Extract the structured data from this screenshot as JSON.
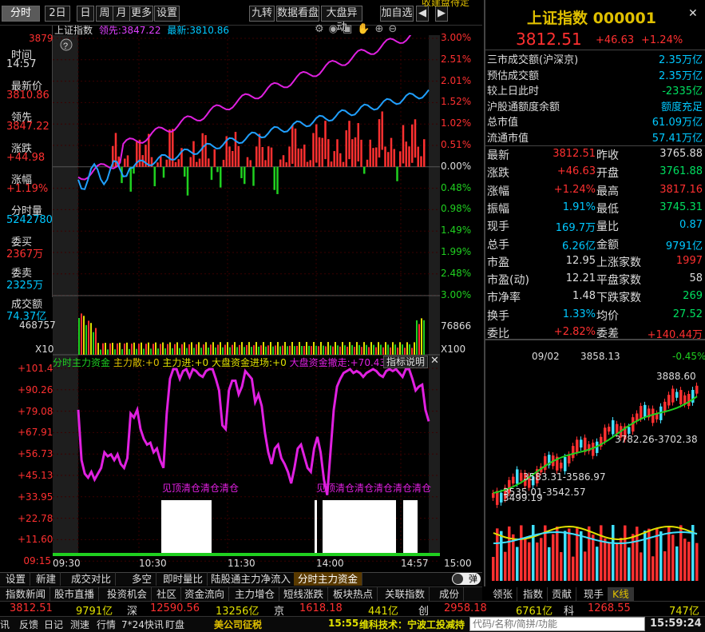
{
  "toolbar": {
    "items": [
      "分时",
      "2日",
      "日",
      "周",
      "月",
      "更多",
      "设置",
      "九转",
      "数据看盘",
      "大盘异动",
      "加自选"
    ],
    "ticker_partial": "收建盘待定"
  },
  "index_header": {
    "name": "上证指数",
    "code": "000001",
    "price": "3812.51",
    "change": "+46.63",
    "change_pct": "+1.24%"
  },
  "chart_header": {
    "name": "上证指数",
    "lead_label": "领先:",
    "lead_value": "3847.22",
    "latest_label": "最新:",
    "latest_value": "3810.86"
  },
  "left_info": [
    {
      "label": "时间",
      "value": "14:57",
      "color": "#dddddd"
    },
    {
      "label": "最新价",
      "value": "3810.86",
      "color": "#ff3030"
    },
    {
      "label": "领先",
      "value": "3847.22",
      "color": "#ff3030"
    },
    {
      "label": "涨跌",
      "value": "+44.98",
      "color": "#ff3030"
    },
    {
      "label": "涨幅",
      "value": "+1.19%",
      "color": "#ff3030"
    },
    {
      "label": "分时量",
      "value": "5242780",
      "color": "#00c8ff"
    },
    {
      "label": "委买",
      "value": "2367万",
      "color": "#ff3030"
    },
    {
      "label": "委卖",
      "value": "2325万",
      "color": "#00c8ff"
    },
    {
      "label": "成交额",
      "value": "74.37亿",
      "color": "#00c8ff"
    }
  ],
  "y_left_top": "3879",
  "pct_axis": [
    "3.00%",
    "2.51%",
    "2.01%",
    "1.52%",
    "1.02%",
    "0.51%",
    "0.00%",
    "0.48%",
    "0.98%",
    "1.49%",
    "1.99%",
    "2.48%",
    "3.00%"
  ],
  "volume": {
    "left_value": "468757",
    "right_value": "76866",
    "left_mult": "X10",
    "right_mult": "X100"
  },
  "indicator": {
    "title": "分时主力资金",
    "a_label": "主力散:",
    "a_value": "+0",
    "b_label": "主力进:",
    "b_value": "+0",
    "c_label": "大盘资金进场:",
    "c_value": "+0",
    "d_label": "大盘资金撤走:",
    "d_value": "+70.43",
    "help": "指标说明",
    "note_a": "见顶清仓清仓清仓",
    "note_b": "见顶清仓清仓清仓清仓清仓",
    "axis": [
      "+101.4",
      "+90.26",
      "+79.08",
      "+67.91",
      "+56.73",
      "+45.13",
      "+33.95",
      "+22.78",
      "+11.60",
      "09:15"
    ],
    "series": [
      80,
      54,
      47,
      45,
      48,
      44,
      47,
      50,
      58,
      56,
      57,
      54,
      57,
      52,
      50,
      55,
      78,
      76,
      80,
      70,
      65,
      62,
      63,
      58,
      60,
      54,
      50,
      78,
      96,
      101,
      101,
      96,
      100,
      101,
      97,
      101,
      100,
      98,
      97,
      100,
      101,
      101,
      96,
      90,
      72,
      70,
      90,
      95,
      95,
      88,
      92,
      100,
      98,
      96,
      84,
      88,
      82,
      68,
      58,
      52,
      60,
      62,
      55,
      52,
      48,
      42,
      50,
      60,
      62,
      56,
      50,
      48,
      60,
      66,
      58,
      44,
      36,
      58,
      80,
      92,
      96,
      99,
      100,
      101,
      99,
      100,
      99,
      97,
      99,
      100,
      101,
      100,
      98,
      97,
      100,
      101,
      100,
      101,
      99,
      97,
      101,
      101,
      96,
      90,
      92,
      93,
      80,
      74
    ]
  },
  "time_axis": [
    "09:30",
    "10:30",
    "11:30",
    "14:00",
    "14:57",
    "15:00"
  ],
  "bottom_tabs": [
    "设置",
    "新建",
    "成交对比",
    "多空",
    "即时量比",
    "陆股通主力净流入",
    "分时主力资金"
  ],
  "toggle_label": "弹",
  "stats_block": {
    "lines": [
      {
        "label": "三市成交额(沪深京)",
        "value": "2.35万亿",
        "color": "#00c8ff"
      },
      {
        "label": "预估成交额",
        "value": "2.35万亿",
        "color": "#00c8ff"
      },
      {
        "label": "较上日此时",
        "value": "-2335亿",
        "color": "#00e060"
      },
      {
        "label": "沪股通额度余额",
        "value": "额度充足",
        "color": "#00c8ff"
      },
      {
        "label": "总市值",
        "value": "61.09万亿",
        "color": "#00c8ff"
      },
      {
        "label": "流通市值",
        "value": "57.41万亿",
        "color": "#00c8ff"
      }
    ]
  },
  "grid_rows": [
    {
      "k1": "最新",
      "v1": "3812.51",
      "c1": "#ff3030",
      "k2": "昨收",
      "v2": "3765.88",
      "c2": "#dddddd"
    },
    {
      "k1": "涨跌",
      "v1": "+46.63",
      "c1": "#ff3030",
      "k2": "开盘",
      "v2": "3761.88",
      "c2": "#00e060"
    },
    {
      "k1": "涨幅",
      "v1": "+1.24%",
      "c1": "#ff3030",
      "k2": "最高",
      "v2": "3817.16",
      "c2": "#ff3030"
    },
    {
      "k1": "振幅",
      "v1": "1.91%",
      "c1": "#00c8ff",
      "k2": "最低",
      "v2": "3745.31",
      "c2": "#00e060"
    },
    {
      "k1": "现手",
      "v1": "169.7万",
      "c1": "#00c8ff",
      "k2": "量比",
      "v2": "0.87",
      "c2": "#00c8ff"
    },
    {
      "k1": "总手",
      "v1": "6.26亿",
      "c1": "#00c8ff",
      "k2": "金额",
      "v2": "9791亿",
      "c2": "#00c8ff"
    },
    {
      "k1": "市盈",
      "v1": "12.95",
      "c1": "#dddddd",
      "k2": "上涨家数",
      "v2": "1997",
      "c2": "#ff3030"
    },
    {
      "k1": "市盈(动)",
      "v1": "12.21",
      "c1": "#dddddd",
      "k2": "平盘家数",
      "v2": "58",
      "c2": "#dddddd"
    },
    {
      "k1": "市净率",
      "v1": "1.48",
      "c1": "#dddddd",
      "k2": "下跌家数",
      "v2": "269",
      "c2": "#00e060"
    },
    {
      "k1": "换手",
      "v1": "1.33%",
      "c1": "#00c8ff",
      "k2": "均价",
      "v2": "27.52",
      "c2": "#00e060"
    },
    {
      "k1": "委比",
      "v1": "+2.82%",
      "c1": "#ff3030",
      "k2": "委差",
      "v2": "+140.44万",
      "c2": "#ff3030"
    }
  ],
  "kline": {
    "date": "09/02",
    "close": "3858.13",
    "pct": "-0.45%",
    "hi_label": "3888.60",
    "mid_label": "3782.26-3702.38",
    "lo_label": "3583.31-3586.97",
    "low1": "3535.01-3542.57",
    "low2": "3499.19"
  },
  "right_tabs": [
    "领张",
    "指数",
    "贡献",
    "现手",
    "K线"
  ],
  "news_tabs": [
    "指数新闻",
    "股市直播",
    "投资机会",
    "社区",
    "资金流向",
    "主力增仓",
    "短线涨跌",
    "板块热点",
    "关联指数",
    "成份"
  ],
  "status": {
    "sh": "3812.51",
    "sh_amt": "9791亿",
    "sz_label": "深",
    "sz": "12590.56",
    "sz_amt": "13256亿",
    "bj_label": "京",
    "bj": "1618.18",
    "bj_amt": "441亿",
    "cy_label": "创",
    "cy": "2958.18",
    "cy_amt": "6761亿",
    "bt_label": "科",
    "bt": "1268.55",
    "bt_amt": "747亿"
  },
  "footer": {
    "items": [
      "讯",
      "反馈",
      "日记",
      "测速",
      "行情",
      "7*24快讯",
      "盯盘"
    ],
    "headline": "美公司征税",
    "flash_time": "15:55",
    "flash_text": "维科技术：宁波工投减持",
    "search_placeholder": "代码/名称/简拼/功能",
    "clock": "15:59:24"
  }
}
